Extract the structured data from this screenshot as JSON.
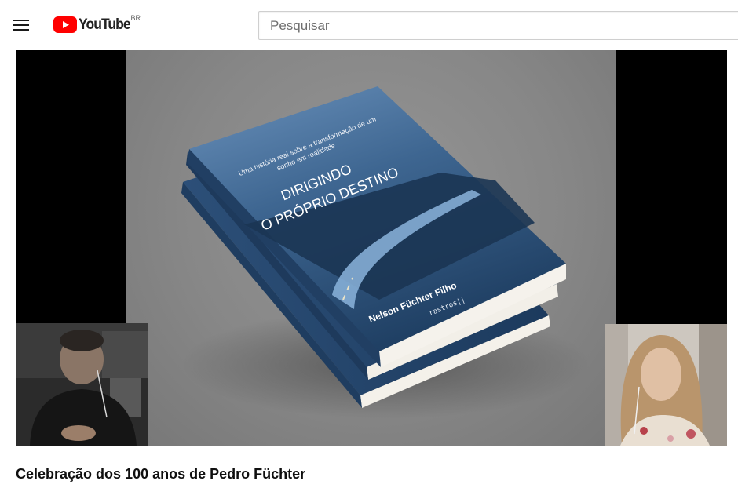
{
  "header": {
    "logo_text": "YouTube",
    "region": "BR",
    "search_placeholder": "Pesquisar",
    "icons": [
      "menu-icon",
      "youtube-logo-icon"
    ],
    "colors": {
      "brand_red": "#ff0000",
      "text": "#212121"
    }
  },
  "book": {
    "tagline_line1": "Uma história real sobre a transformação de um",
    "tagline_line2": "sonho em realidade",
    "title_line1": "DIRIGINDO",
    "title_line2": "O PRÓPRIO DESTINO",
    "author": "Nelson Füchter Filho",
    "publisher": "rastros||"
  },
  "video": {
    "title": "Celebração dos 100 anos de Pedro Füchter"
  }
}
